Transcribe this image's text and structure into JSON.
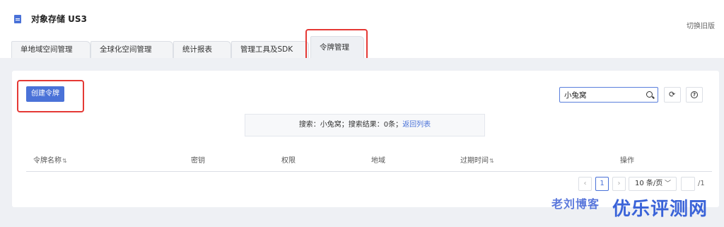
{
  "header": {
    "app_title": "对象存储 US3",
    "switch_link": "切换旧版",
    "app_icon": "document-icon"
  },
  "tabs": [
    {
      "label": "单地域空间管理",
      "active": false
    },
    {
      "label": "全球化空间管理",
      "active": false
    },
    {
      "label": "统计报表",
      "active": false
    },
    {
      "label": "管理工具及SDK",
      "active": false
    },
    {
      "label": "令牌管理",
      "active": true
    }
  ],
  "toolbar": {
    "create_label": "创建令牌",
    "search_value": "小兔窝",
    "search_icon": "search-icon",
    "refresh_icon": "refresh-icon",
    "help_icon": "help-icon"
  },
  "notice": {
    "prefix": "搜索：小兔窝；搜索结果：0条；",
    "link": "返回列表"
  },
  "table": {
    "columns": [
      "令牌名称",
      "密钥",
      "权限",
      "地域",
      "过期时间",
      "操作"
    ],
    "sort_glyph": "⇅",
    "rows": []
  },
  "pagination": {
    "prev": "‹",
    "current": "1",
    "next": "›",
    "page_size": "10 条/页",
    "total_pages": "/1"
  },
  "watermark": {
    "left_text": "老刘博客",
    "right_text": "优乐评测网"
  },
  "colors": {
    "accent": "#4a72d8",
    "highlight": "#e53935",
    "background": "#eef0f4"
  }
}
